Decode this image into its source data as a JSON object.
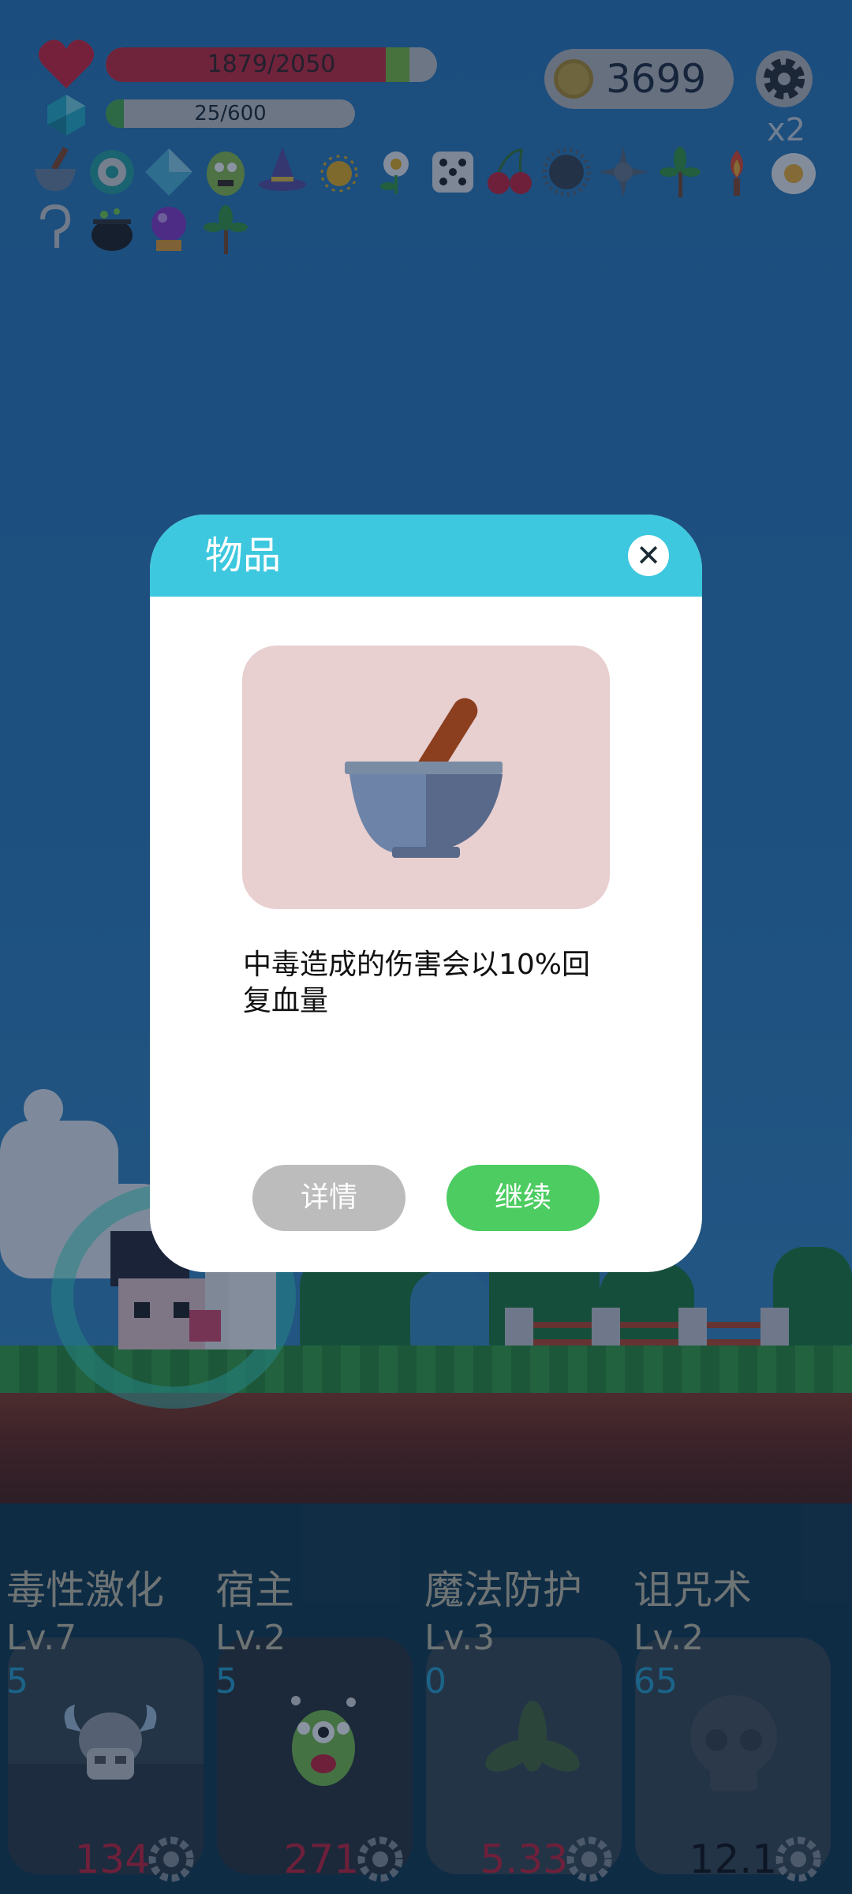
{
  "hud": {
    "hp_text": "1879/2050",
    "hp_fraction": 0.917,
    "xp_text": "25/600",
    "xp_fraction": 0.042,
    "coins": "3699",
    "multiplier": "x2"
  },
  "items_bar": [
    "mortar-icon",
    "ring-icon",
    "crystal-icon",
    "zombie-icon",
    "wizard-hat-icon",
    "sun-orb-icon",
    "flower-icon",
    "dice-icon",
    "cherry-icon",
    "spiked-ball-icon",
    "spike-star-icon",
    "sapling-icon",
    "torch-icon",
    "egg-icon",
    "hook-icon",
    "cauldron-icon",
    "crystal-ball-icon",
    "small-tree-icon"
  ],
  "skills": [
    {
      "name": "毒性激化",
      "level": "Lv.7",
      "count": "5",
      "value": "134",
      "icon": "viking-skull-icon"
    },
    {
      "name": "宿主",
      "level": "Lv.2",
      "count": "5",
      "value": "271",
      "icon": "green-monster-icon"
    },
    {
      "name": "魔法防护",
      "level": "Lv.3",
      "count": "0",
      "value": "5.33",
      "icon": "leaf-icon"
    },
    {
      "name": "诅咒术",
      "level": "Lv.2",
      "count": "65",
      "value": "12.1",
      "icon": "skull-icon"
    }
  ],
  "dialog": {
    "title": "物品",
    "item_icon": "mortar-pestle-icon",
    "description": "中毒造成的伤害会以10%回复血量",
    "detail_label": "详情",
    "continue_label": "继续"
  },
  "colors": {
    "header": "#3ec8df",
    "continue": "#4ccc61",
    "detail": "#bcbcbc",
    "hp": "#cc2b3d",
    "xp": "#4cae4c"
  }
}
